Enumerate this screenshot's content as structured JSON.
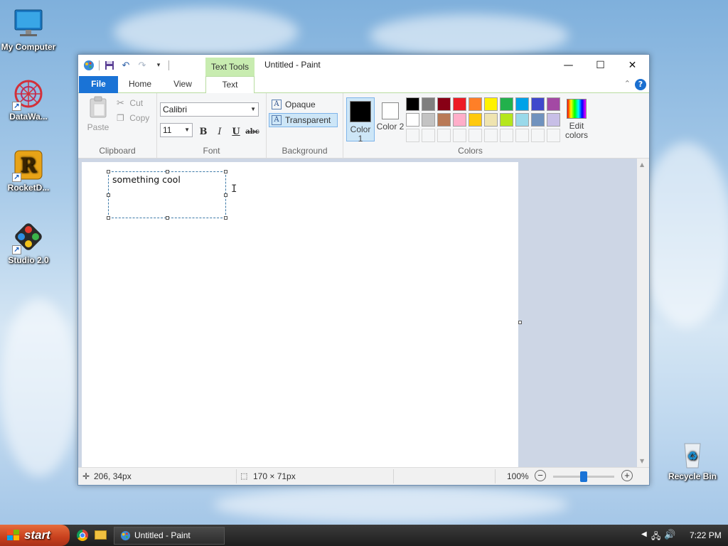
{
  "desktop": {
    "icons": [
      {
        "label": "My Computer",
        "icon": "monitor-icon"
      },
      {
        "label": "DataWa...",
        "icon": "datawatch-icon"
      },
      {
        "label": "RocketD...",
        "icon": "rocket-icon"
      },
      {
        "label": "Studio 2.0",
        "icon": "studio-icon"
      },
      {
        "label": "Recycle Bin",
        "icon": "recycle-bin-icon"
      }
    ]
  },
  "window": {
    "title": "Untitled - Paint",
    "context_tab": "Text Tools",
    "controls": {
      "minimize": "—",
      "maximize": "☐",
      "close": "✕"
    },
    "qat_icons": [
      "paint-app-icon",
      "save-icon",
      "undo-icon",
      "redo-icon",
      "customize-icon"
    ]
  },
  "tabs": {
    "file": "File",
    "home": "Home",
    "view": "View",
    "text": "Text",
    "collapse": "⌃",
    "help": "?"
  },
  "ribbon": {
    "clipboard": {
      "label": "Clipboard",
      "paste": "Paste",
      "cut": "Cut",
      "copy": "Copy"
    },
    "font": {
      "label": "Font",
      "family": "Calibri",
      "size": "11",
      "bold": "B",
      "italic": "I",
      "underline": "U",
      "strike": "abc"
    },
    "background": {
      "label": "Background",
      "opaque": "Opaque",
      "transparent": "Transparent",
      "selected": "Transparent"
    },
    "colors": {
      "label": "Colors",
      "color1": "Color 1",
      "color2": "Color 2",
      "edit": "Edit colors",
      "color1_value": "#000000",
      "color2_value": "#ffffff",
      "palette_row1": [
        "#000000",
        "#7f7f7f",
        "#880015",
        "#ed1c24",
        "#ff7f27",
        "#fff200",
        "#22b14c",
        "#00a2e8",
        "#3f48cc",
        "#a349a4"
      ],
      "palette_row2": [
        "#ffffff",
        "#c3c3c3",
        "#b97a57",
        "#ffaec9",
        "#ffc90e",
        "#efe4b0",
        "#b5e61d",
        "#99d9ea",
        "#7092be",
        "#c8bfe7"
      ]
    }
  },
  "canvas": {
    "text": "something cool"
  },
  "status": {
    "cursor_pos": "206, 34px",
    "selection_size": "170 × 71px",
    "zoom": "100%",
    "zoom_level": 0.5
  },
  "taskbar": {
    "start": "start",
    "task": "Untitled - Paint",
    "time": "7:22 PM"
  }
}
